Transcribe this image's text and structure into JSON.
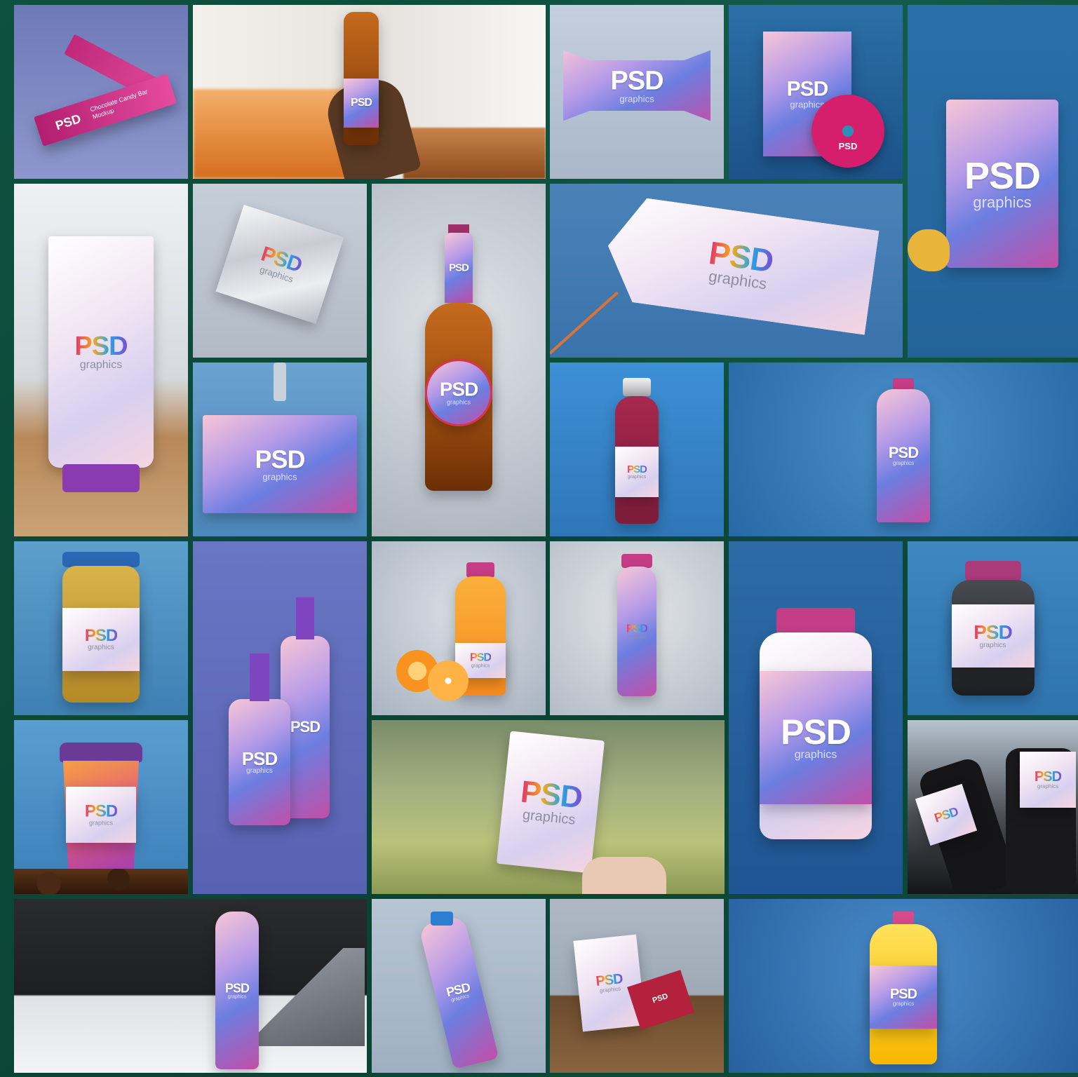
{
  "brand": {
    "logo_text": "PSD",
    "tagline": "graphics",
    "accent_colors": [
      "#e0326d",
      "#f6a91b",
      "#27a7e0",
      "#7a4cd6"
    ]
  },
  "tiles": [
    {
      "name": "candy-bar-mockup",
      "extra": "Chocolate Candy Bar Mockup"
    },
    {
      "name": "beer-bottle-hand-mockup"
    },
    {
      "name": "candy-wrapper-mockup"
    },
    {
      "name": "dvd-case-mockup",
      "extra": "PSD"
    },
    {
      "name": "chips-bag-mockup"
    },
    {
      "name": "cosmetic-tube-mockup"
    },
    {
      "name": "foil-pouch-mockup"
    },
    {
      "name": "beer-bottle-mockup"
    },
    {
      "name": "hang-tag-mockup"
    },
    {
      "name": "id-card-badge-mockup"
    },
    {
      "name": "red-juice-bottle-mockup"
    },
    {
      "name": "plastic-bottle-mockup"
    },
    {
      "name": "mustard-jar-mockup"
    },
    {
      "name": "spray-bottles-mockup"
    },
    {
      "name": "orange-juice-bottle-mockup"
    },
    {
      "name": "smoothie-bottle-mockup"
    },
    {
      "name": "supplement-jar-mockup"
    },
    {
      "name": "dark-jar-mockup"
    },
    {
      "name": "coffee-cup-mockup"
    },
    {
      "name": "business-card-hand-mockup"
    },
    {
      "name": "socks-packaging-mockup"
    },
    {
      "name": "water-bottle-laptop-mockup"
    },
    {
      "name": "sport-bottle-mockup"
    },
    {
      "name": "business-cards-mockup",
      "extra": "PSD"
    },
    {
      "name": "oil-bottle-mockup"
    }
  ]
}
